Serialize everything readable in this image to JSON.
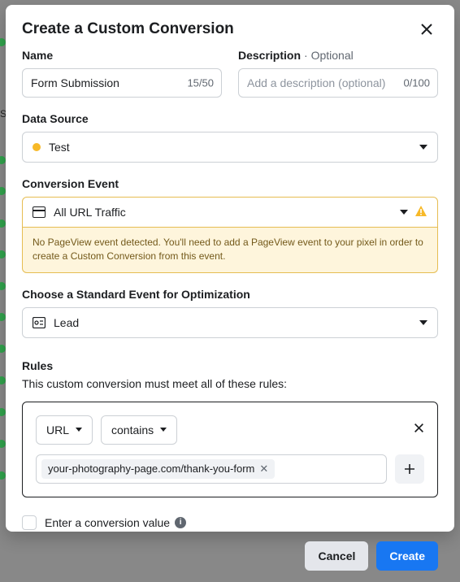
{
  "modal": {
    "title": "Create a Custom Conversion",
    "name_label": "Name",
    "name_value": "Form Submission",
    "name_counter": "15/50",
    "desc_label": "Description",
    "desc_optional": "· Optional",
    "desc_placeholder": "Add a description (optional)",
    "desc_counter": "0/100",
    "datasource_label": "Data Source",
    "datasource_value": "Test",
    "conv_label": "Conversion Event",
    "conv_value": "All URL Traffic",
    "warn_text": "No PageView event detected. You'll need to add a PageView event to your pixel in order to create a Custom Conversion from this event.",
    "std_label": "Choose a Standard Event for Optimization",
    "std_value": "Lead",
    "rules_label": "Rules",
    "rules_sub": "This custom conversion must meet all of these rules:",
    "rule_field": "URL",
    "rule_op": "contains",
    "rule_value": "your-photography-page.com/thank-you-form",
    "cb_label": "Enter a conversion value",
    "cancel": "Cancel",
    "create": "Create"
  },
  "bg_left_text": "St"
}
